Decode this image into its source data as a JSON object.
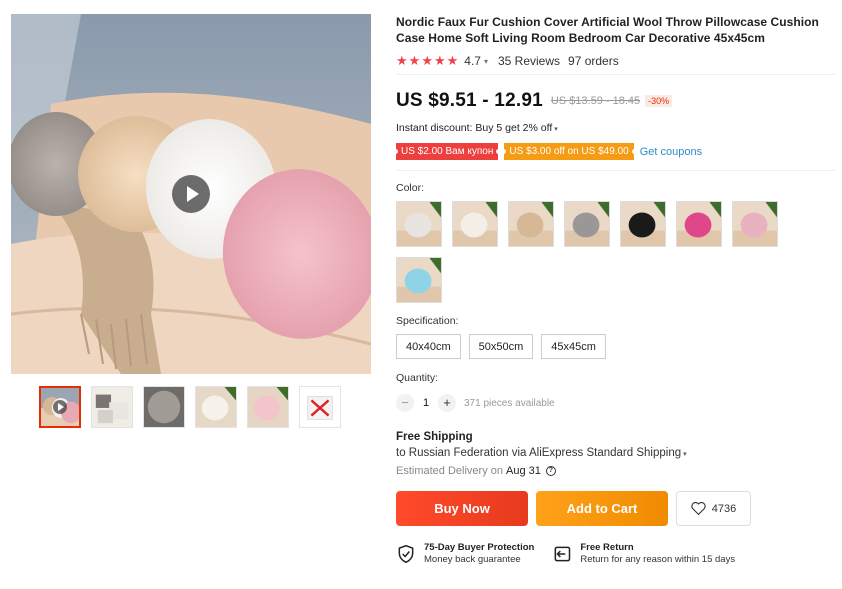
{
  "product": {
    "title": "Nordic Faux Fur Cushion Cover Artificial Wool Throw Pillowcase Cushion Case Home Soft Living Room Bedroom Car Decorative 45x45cm",
    "rating": "4.7",
    "stars": 5,
    "reviews": "35 Reviews",
    "orders": "97 orders"
  },
  "price": {
    "current": "US $9.51 - 12.91",
    "original": "US $13.59 - 18.45",
    "discount": "-30%"
  },
  "instant_discount": "Instant discount: Buy 5 get 2% off",
  "coupons": [
    {
      "label": "US $2.00 Вам купон",
      "color": "#ee3f3f"
    },
    {
      "label": "US $3.00 off on US $49.00",
      "color": "#f59b14"
    }
  ],
  "get_coupons": "Get coupons",
  "color_label": "Color:",
  "swatches": [
    {
      "name": "light-grey",
      "pillow": "#e8e4df"
    },
    {
      "name": "ivory",
      "pillow": "#f3eee6"
    },
    {
      "name": "camel",
      "pillow": "#d7b896"
    },
    {
      "name": "grey",
      "pillow": "#9a9896"
    },
    {
      "name": "black",
      "pillow": "#1a1a1a"
    },
    {
      "name": "rose-red",
      "pillow": "#e0468a"
    },
    {
      "name": "light-pink",
      "pillow": "#e8b2c0"
    },
    {
      "name": "sky-blue",
      "pillow": "#8fd3e6"
    }
  ],
  "spec_label": "Specification:",
  "specs": [
    "40x40cm",
    "50x50cm",
    "45x45cm"
  ],
  "quantity_label": "Quantity:",
  "quantity": {
    "minus": "−",
    "value": "1",
    "plus": "+",
    "available": "371 pieces available"
  },
  "shipping": {
    "title": "Free Shipping",
    "destination": "to Russian Federation via AliExpress Standard Shipping",
    "delivery_prefix": "Estimated Delivery on",
    "delivery_date": "Aug 31",
    "help": "?"
  },
  "buttons": {
    "buy_now": "Buy Now",
    "add_to_cart": "Add to Cart",
    "wishlist_count": "4736"
  },
  "guarantees": [
    {
      "title": "75-Day Buyer Protection",
      "subtitle": "Money back guarantee",
      "icon": "shield-check-icon"
    },
    {
      "title": "Free Return",
      "subtitle": "Return for any reason within 15 days",
      "icon": "return-icon"
    }
  ],
  "colors": {
    "accent_red": "#e62e04",
    "star": "#f0424a",
    "link_blue": "#2e8bc9",
    "buy_now": "#ff4a2b",
    "add_to_cart": "#ffa21a"
  }
}
